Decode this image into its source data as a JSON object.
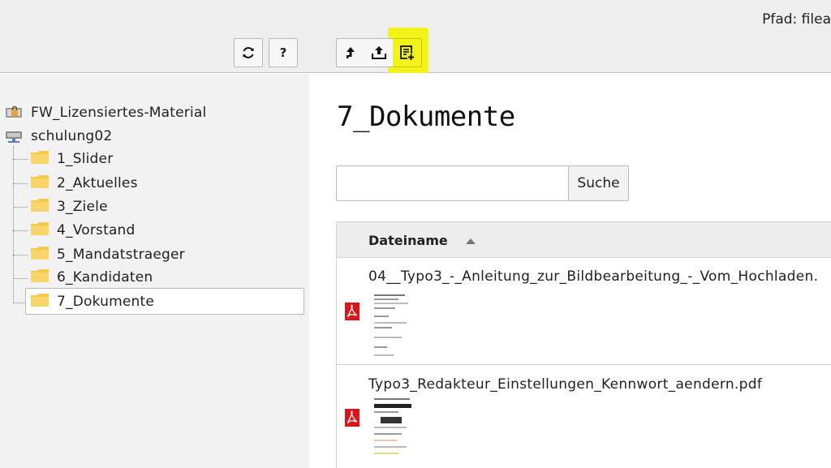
{
  "header": {
    "path_text": "Pfad: filea"
  },
  "toolbar": {
    "refresh_icon": "refresh-icon",
    "help_label": "?",
    "up_icon": "arrow-up-icon",
    "upload_icon": "upload-icon",
    "new_file_icon": "new-file-icon",
    "highlight_color": "#f3f31a"
  },
  "tree": {
    "storages": [
      {
        "label": "FW_Lizensiertes-Material",
        "icon": "locked-storage-icon"
      },
      {
        "label": "schulung02",
        "icon": "storage-icon"
      }
    ],
    "folders": [
      {
        "label": "1_Slider"
      },
      {
        "label": "2_Aktuelles"
      },
      {
        "label": "3_Ziele"
      },
      {
        "label": "4_Vorstand"
      },
      {
        "label": "5_Mandatstraeger"
      },
      {
        "label": "6_Kandidaten"
      },
      {
        "label": "7_Dokumente"
      }
    ],
    "selected_folder": "7_Dokumente",
    "folder_color": "#f5c94a"
  },
  "main": {
    "title": "7_Dokumente",
    "search": {
      "placeholder": "",
      "value": "",
      "button_label": "Suche"
    },
    "table": {
      "column_header": "Dateiname",
      "sort_icon": "sort-ascending-icon",
      "rows": [
        {
          "filename": "04__Typo3_-_Anleitung_zur_Bildbearbeitung_-_Vom_Hochladen.",
          "icon": "pdf-icon"
        },
        {
          "filename": "Typo3_Redakteur_Einstellungen_Kennwort_aendern.pdf",
          "icon": "pdf-icon"
        }
      ]
    }
  }
}
